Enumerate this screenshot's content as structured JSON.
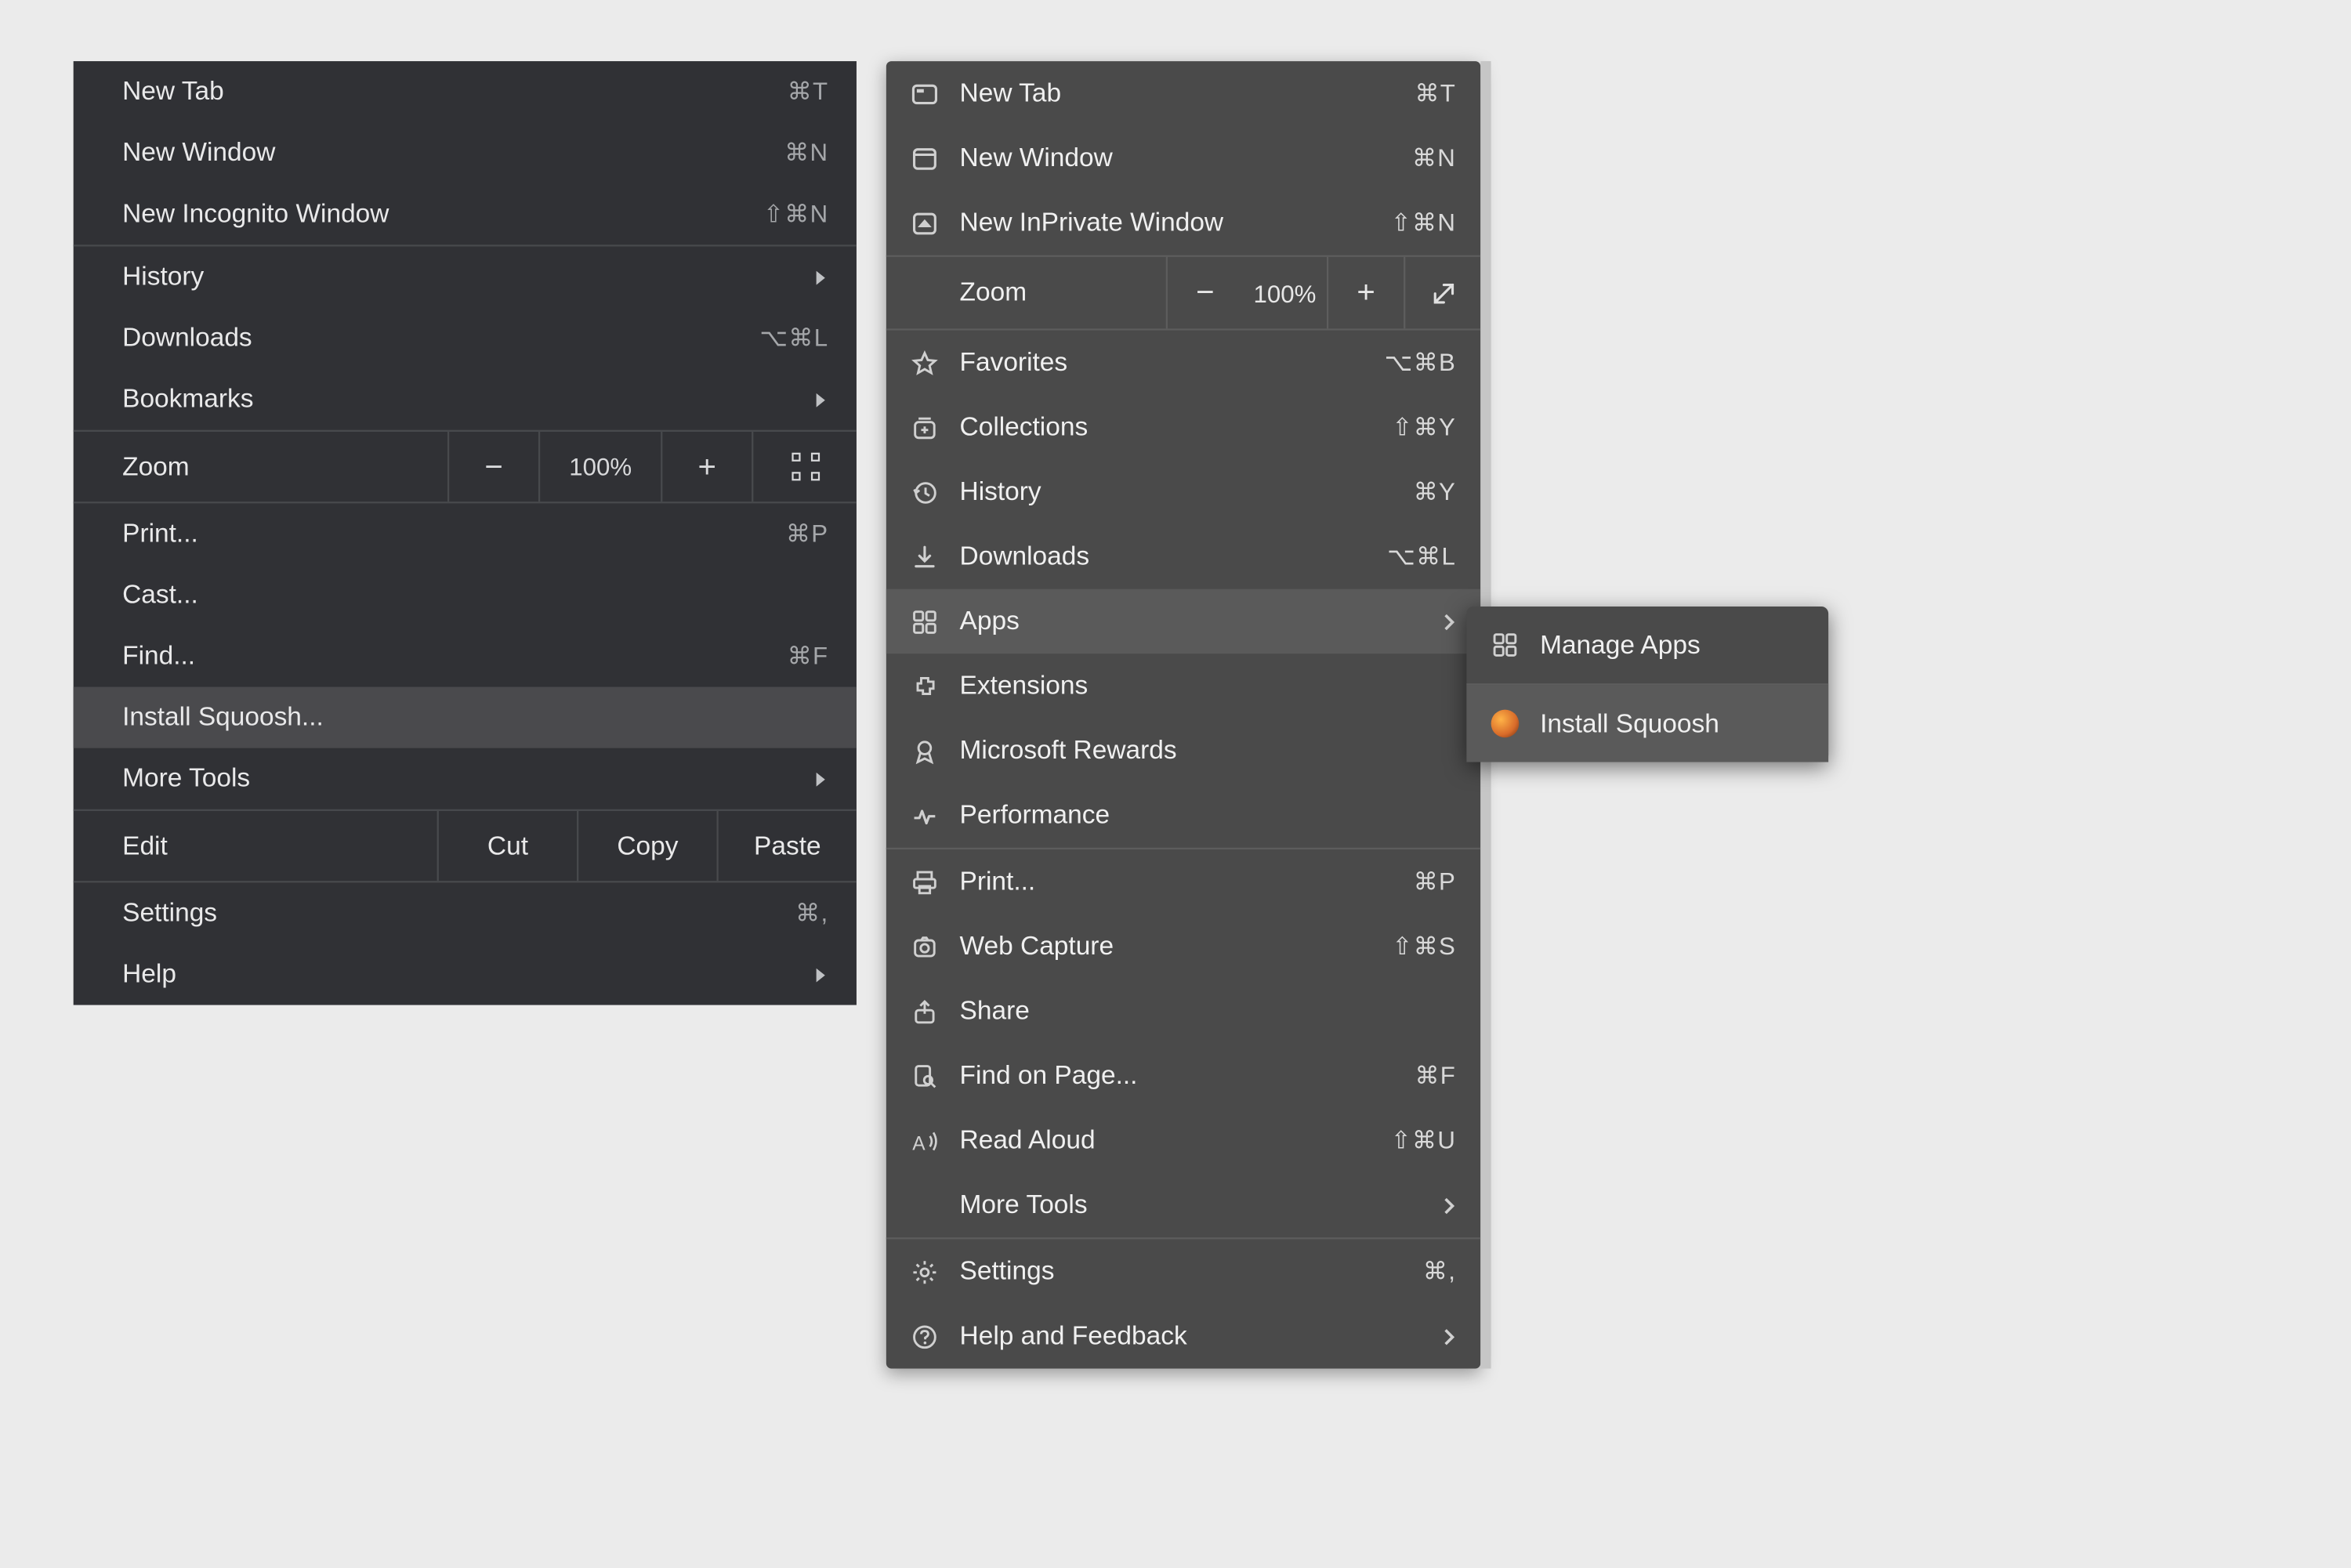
{
  "chrome": {
    "new_tab": {
      "label": "New Tab",
      "shortcut": "⌘T"
    },
    "new_window": {
      "label": "New Window",
      "shortcut": "⌘N"
    },
    "new_incognito": {
      "label": "New Incognito Window",
      "shortcut": "⇧⌘N"
    },
    "history": {
      "label": "History"
    },
    "downloads": {
      "label": "Downloads",
      "shortcut": "⌥⌘L"
    },
    "bookmarks": {
      "label": "Bookmarks"
    },
    "zoom": {
      "label": "Zoom",
      "value": "100%",
      "minus": "−",
      "plus": "+"
    },
    "print": {
      "label": "Print...",
      "shortcut": "⌘P"
    },
    "cast": {
      "label": "Cast..."
    },
    "find": {
      "label": "Find...",
      "shortcut": "⌘F"
    },
    "install": {
      "label": "Install Squoosh..."
    },
    "more_tools": {
      "label": "More Tools"
    },
    "edit": {
      "label": "Edit",
      "cut": "Cut",
      "copy": "Copy",
      "paste": "Paste"
    },
    "settings": {
      "label": "Settings",
      "shortcut": "⌘,"
    },
    "help": {
      "label": "Help"
    }
  },
  "edge": {
    "new_tab": {
      "label": "New Tab",
      "shortcut": "⌘T"
    },
    "new_window": {
      "label": "New Window",
      "shortcut": "⌘N"
    },
    "new_inprivate": {
      "label": "New InPrivate Window",
      "shortcut": "⇧⌘N"
    },
    "zoom": {
      "label": "Zoom",
      "value": "100%",
      "minus": "−",
      "plus": "+"
    },
    "favorites": {
      "label": "Favorites",
      "shortcut": "⌥⌘B"
    },
    "collections": {
      "label": "Collections",
      "shortcut": "⇧⌘Y"
    },
    "history": {
      "label": "History",
      "shortcut": "⌘Y"
    },
    "downloads": {
      "label": "Downloads",
      "shortcut": "⌥⌘L"
    },
    "apps": {
      "label": "Apps"
    },
    "extensions": {
      "label": "Extensions"
    },
    "microsoft_rewards": {
      "label": "Microsoft Rewards"
    },
    "performance": {
      "label": "Performance"
    },
    "print": {
      "label": "Print...",
      "shortcut": "⌘P"
    },
    "web_capture": {
      "label": "Web Capture",
      "shortcut": "⇧⌘S"
    },
    "share": {
      "label": "Share"
    },
    "find_on_page": {
      "label": "Find on Page...",
      "shortcut": "⌘F"
    },
    "read_aloud": {
      "label": "Read Aloud",
      "shortcut": "⇧⌘U"
    },
    "more_tools": {
      "label": "More Tools"
    },
    "settings": {
      "label": "Settings",
      "shortcut": "⌘,"
    },
    "help_feedback": {
      "label": "Help and Feedback"
    }
  },
  "edge_submenu": {
    "manage_apps": {
      "label": "Manage Apps"
    },
    "install_squoosh": {
      "label": "Install Squoosh"
    }
  }
}
